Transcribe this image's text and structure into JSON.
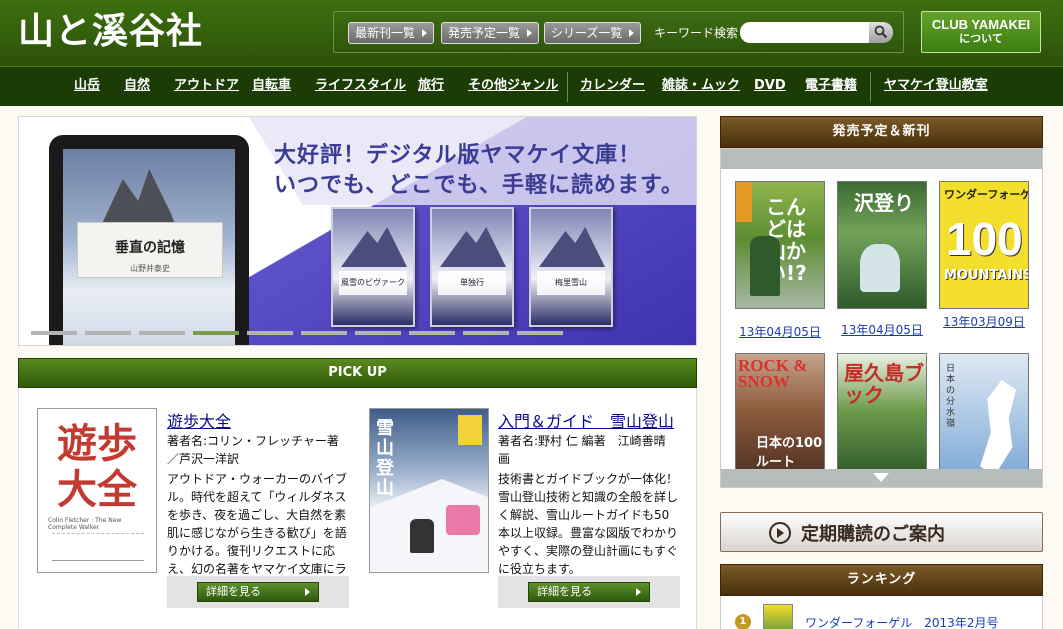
{
  "header": {
    "logo": "山と溪谷社",
    "buttons": [
      "最新刊一覧",
      "発売予定一覧",
      "シリーズ一覧"
    ],
    "keyword_label": "キーワード検索",
    "keyword_value": "",
    "club_line1": "CLUB YAMAKEI",
    "club_line2": "について"
  },
  "nav": {
    "items": [
      "山岳",
      "自然",
      "アウトドア",
      "自転車",
      "ライフスタイル",
      "旅行",
      "その他ジャンル",
      "カレンダー",
      "雑誌・ムック",
      "DVD",
      "電子書籍",
      "ヤマケイ登山教室"
    ]
  },
  "banner": {
    "headline1": "大好評！デジタル版ヤマケイ文庫！",
    "headline2": "いつでも、どこでも、手軽に読めます。",
    "tablet_title": "垂直の記憶",
    "tablet_author": "山野井泰史",
    "books": [
      "風雪のビヴァーク",
      "単独行",
      "梅里雪山"
    ],
    "slide_count": 10,
    "active_slide": 4
  },
  "pickup": {
    "title": "PICK UP",
    "items": [
      {
        "title": "遊歩大全",
        "author": "著者名:コリン・フレッチャー著／芦沢一洋訳",
        "desc": "アウトドア・ウォーカーのバイブル。時代を超えて「ウィルダネスを歩き、夜を過ごし、大自然を素肌に感じながら生きる歓び」を語りかける。復刊リクエストに応え、幻の名著をヤマケイ文庫にラインナップ！",
        "cover_text1": "遊歩",
        "cover_text2": "大全",
        "cover_sub": "Colin Fletcher : The New Complete Walker",
        "detail": "詳細を見る"
      },
      {
        "title": "入門＆ガイド　雪山登山",
        "author": "著者名:野村 仁 編著　江崎善晴 画",
        "desc": "技術書とガイドブックが一体化！雪山登山技術と知識の全般を詳しく解説、雪山ルートガイドも50本以上収録。豊富な図版でわかりやすく、実際の登山計画にもすぐに役立ちます。",
        "cover_text": "雪山登山",
        "detail": "詳細を見る"
      }
    ]
  },
  "upcoming": {
    "title": "発売予定＆新刊",
    "books": [
      {
        "cover": "こんどは山かい!?",
        "date": "13年04月05日"
      },
      {
        "cover": "沢登り",
        "date": "13年04月05日"
      },
      {
        "cover_top": "ワンダーフォーゲル",
        "cover_num": "100",
        "cover_sub": "MOUNTAINS",
        "date": "13年03月09日"
      },
      {
        "cover": "ROCK & SNOW",
        "cover_sub": "日本の100ルート"
      },
      {
        "cover": "屋久島ブック"
      },
      {
        "cover": "日本の分水嶺"
      }
    ]
  },
  "subscribe": {
    "label": "定期購読のご案内"
  },
  "ranking": {
    "title": "ランキング",
    "first_rank": "1",
    "first_text": "ワンダーフォーゲル　2013年2月号"
  }
}
